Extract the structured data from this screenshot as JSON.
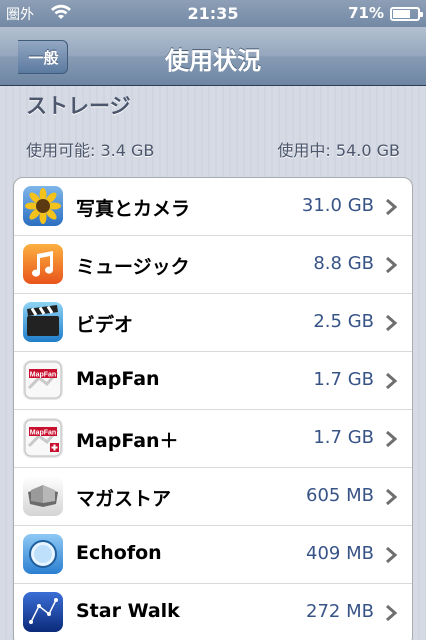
{
  "status_bar": {
    "carrier": "圏外",
    "time": "21:35",
    "battery_percent": "71%",
    "battery_level": 0.71
  },
  "nav": {
    "back_label": "一般",
    "title": "使用状況"
  },
  "storage": {
    "section_title": "ストレージ",
    "available": "使用可能: 3.4 GB",
    "used": "使用中: 54.0 GB"
  },
  "apps": [
    {
      "name": "写真とカメラ",
      "size": "31.0 GB",
      "icon": "photos-icon"
    },
    {
      "name": "ミュージック",
      "size": "8.8 GB",
      "icon": "music-icon"
    },
    {
      "name": "ビデオ",
      "size": "2.5 GB",
      "icon": "videos-icon"
    },
    {
      "name": "MapFan",
      "size": "1.7 GB",
      "icon": "mapfan-icon"
    },
    {
      "name": "MapFan＋",
      "size": "1.7 GB",
      "icon": "mapfan-plus-icon"
    },
    {
      "name": "マガストア",
      "size": "605 MB",
      "icon": "magastore-icon"
    },
    {
      "name": "Echofon",
      "size": "409 MB",
      "icon": "echofon-icon"
    },
    {
      "name": "Star Walk",
      "size": "272 MB",
      "icon": "star-walk-icon"
    }
  ]
}
